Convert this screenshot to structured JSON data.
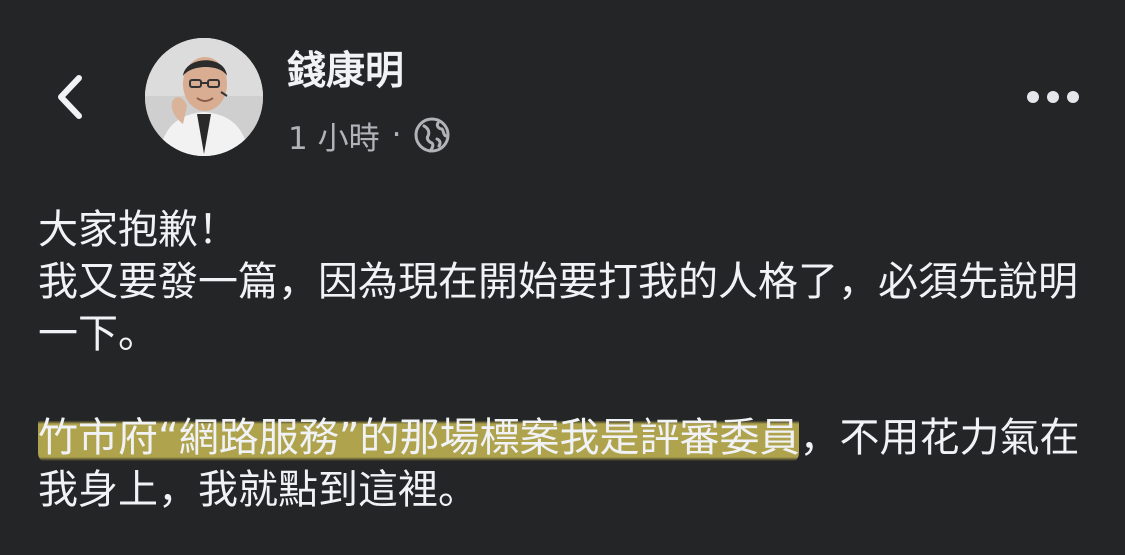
{
  "post": {
    "author": "錢康明",
    "time": "1 小時",
    "separator": "·",
    "audience_icon": "globe-icon",
    "more_icon": "more-horizontal-icon",
    "back_icon": "chevron-left-icon",
    "avatar_icon": "avatar",
    "text": {
      "line1": "大家抱歉！",
      "line2": "我又要發一篇，因為現在開始要打我的人格了，必須先說明一下。",
      "highlighted": "竹市府“網路服務”的那場標案我是評審委員",
      "rest": "，不用花力氣在我身上，我就點到這裡。"
    },
    "colors": {
      "background": "#242526",
      "text": "#f0f2f5",
      "secondary": "#b0b3b8",
      "highlight": "#d6c658"
    }
  }
}
